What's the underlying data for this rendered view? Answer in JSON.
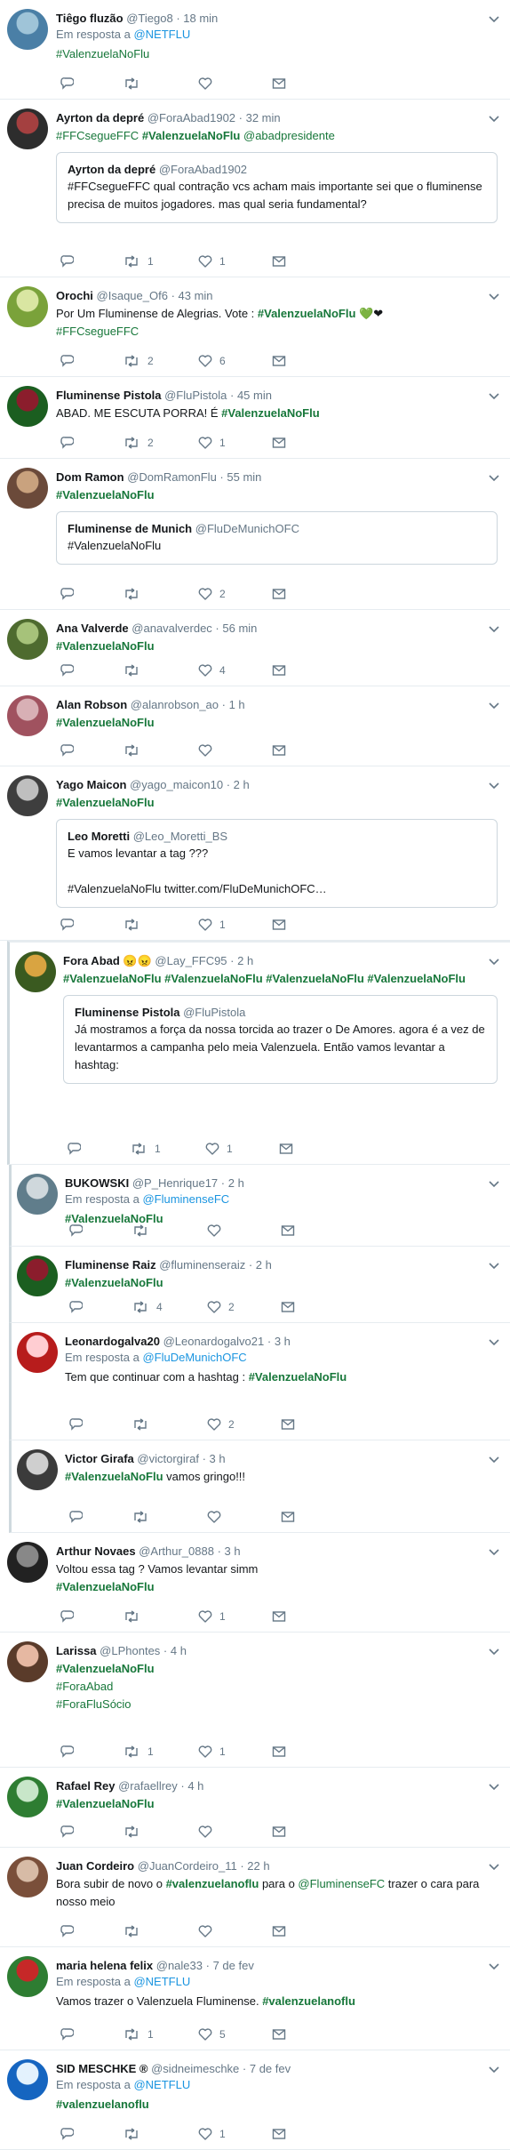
{
  "colors": {
    "hashtag": "#17773a",
    "link": "#1b95e0",
    "muted": "#657786",
    "border": "#e6ecf0"
  },
  "icons": {
    "reply": "reply-icon",
    "retweet": "retweet-icon",
    "like": "heart-icon",
    "dm": "envelope-icon",
    "menu": "chevron-down-icon"
  },
  "tweets": [
    {
      "name": "Tiêgo fluzão",
      "handle": "@Tiego8",
      "time": "18 min",
      "reply_prefix": "Em resposta a",
      "reply_to": "@NETFLU",
      "segments": [
        {
          "t": "#ValenzuelaNoFlu",
          "h": true
        }
      ],
      "rt": "",
      "likes": ""
    },
    {
      "name": "Ayrton da depré",
      "handle": "@ForaAbad1902",
      "time": "32 min",
      "segments": [
        {
          "t": "#FFCsegueFFC",
          "h": true
        },
        {
          "t": " "
        },
        {
          "t": "#ValenzuelaNoFlu",
          "h": true,
          "b": true
        },
        {
          "t": " "
        },
        {
          "t": "@abadpresidente",
          "h": true
        }
      ],
      "quote": {
        "name": "Ayrton da depré",
        "handle": "@ForaAbad1902",
        "text": "#FFCsegueFFC qual contração vcs acham mais importante sei que o fluminense precisa de muitos jogadores. mas qual seria fundamental?"
      },
      "rt": "1",
      "likes": "1"
    },
    {
      "name": "Orochi",
      "handle": "@Isaque_Of6",
      "time": "43 min",
      "segments": [
        {
          "t": "Por Um Fluminense de Alegrias. Vote : "
        },
        {
          "t": "#ValenzuelaNoFlu",
          "h": true,
          "b": true
        },
        {
          "t": " 💚❤"
        },
        {
          "t": "\n"
        },
        {
          "t": "#FFCsegueFFC",
          "h": true
        }
      ],
      "rt": "2",
      "likes": "6"
    },
    {
      "name": "Fluminense Pistola",
      "handle": "@FluPistola",
      "time": "45 min",
      "segments": [
        {
          "t": "ABAD. ME ESCUTA PORRA! É "
        },
        {
          "t": "#ValenzuelaNoFlu",
          "h": true,
          "b": true
        }
      ],
      "rt": "2",
      "likes": "1"
    },
    {
      "name": "Dom Ramon",
      "handle": "@DomRamonFlu",
      "time": "55 min",
      "segments": [
        {
          "t": "#ValenzuelaNoFlu",
          "h": true,
          "b": true
        }
      ],
      "quote": {
        "name": "Fluminense de Munich",
        "handle": "@FluDeMunichOFC",
        "text": "#ValenzuelaNoFlu"
      },
      "rt": "",
      "likes": "2"
    },
    {
      "name": "Ana Valverde",
      "handle": "@anavalverdec",
      "time": "56 min",
      "segments": [
        {
          "t": "#ValenzuelaNoFlu",
          "h": true,
          "b": true
        }
      ],
      "rt": "",
      "likes": "4"
    },
    {
      "name": "Alan Robson",
      "handle": "@alanrobson_ao",
      "time": "1 h",
      "segments": [
        {
          "t": "#ValenzuelaNoFlu",
          "h": true,
          "b": true
        }
      ],
      "rt": "",
      "likes": ""
    },
    {
      "name": "Yago Maicon",
      "handle": "@yago_maicon10",
      "time": "2 h",
      "segments": [
        {
          "t": "#ValenzuelaNoFlu",
          "h": true,
          "b": true
        }
      ],
      "quote": {
        "name": "Leo Moretti",
        "handle": "@Leo_Moretti_BS",
        "text": "E vamos levantar a tag ???\n\n#ValenzuelaNoFlu twitter.com/FluDeMunichOFC…"
      },
      "rt": "",
      "likes": "1"
    },
    {
      "name": "Fora Abad 😠😠",
      "handle": "@Lay_FFC95",
      "time": "2 h",
      "segments": [
        {
          "t": "#ValenzuelaNoFlu #ValenzuelaNoFlu #ValenzuelaNoFlu #ValenzuelaNoFlu",
          "h": true,
          "b": true
        }
      ],
      "quote": {
        "name": "Fluminense Pistola",
        "handle": "@FluPistola",
        "text": "Já mostramos a força da nossa torcida ao trazer o De Amores. agora é a vez de levantarmos a campanha pelo meia Valenzuela. Então vamos levantar a hashtag:"
      },
      "rt": "1",
      "likes": "1"
    },
    {
      "name": "BUKOWSKI",
      "handle": "@P_Henrique17",
      "time": "2 h",
      "reply_prefix": "Em resposta a",
      "reply_to": "@FluminenseFC",
      "segments": [
        {
          "t": "#ValenzuelaNoFlu",
          "h": true,
          "b": true
        }
      ],
      "rt": "",
      "likes": ""
    },
    {
      "name": "Fluminense Raiz",
      "handle": "@fluminenseraiz",
      "time": "2 h",
      "segments": [
        {
          "t": "#ValenzuelaNoFlu",
          "h": true,
          "b": true
        }
      ],
      "rt": "4",
      "likes": "2"
    },
    {
      "name": "Leonardogalva20",
      "handle": "@Leonardogalvo21",
      "time": "3 h",
      "reply_prefix": "Em resposta a",
      "reply_to": "@FluDeMunichOFC",
      "segments": [
        {
          "t": "Tem que continuar com a hashtag : "
        },
        {
          "t": "#ValenzuelaNoFlu",
          "h": true,
          "b": true
        }
      ],
      "rt": "",
      "likes": "2"
    },
    {
      "name": "Victor Girafa",
      "handle": "@victorgiraf",
      "time": "3 h",
      "segments": [
        {
          "t": "#ValenzuelaNoFlu",
          "h": true,
          "b": true
        },
        {
          "t": " vamos gringo!!!"
        }
      ],
      "rt": "",
      "likes": ""
    },
    {
      "name": "Arthur Novaes",
      "handle": "@Arthur_0888",
      "time": "3 h",
      "segments": [
        {
          "t": "Voltou essa tag ? Vamos levantar simm"
        },
        {
          "t": "\n"
        },
        {
          "t": "#ValenzuelaNoFlu",
          "h": true,
          "b": true
        }
      ],
      "rt": "",
      "likes": "1"
    },
    {
      "name": "Larissa",
      "handle": "@LPhontes",
      "time": "4 h",
      "segments": [
        {
          "t": "#ValenzuelaNoFlu",
          "h": true,
          "b": true
        },
        {
          "t": "\n"
        },
        {
          "t": "#ForaAbad",
          "h": true
        },
        {
          "t": "\n"
        },
        {
          "t": "#ForaFluSócio",
          "h": true
        }
      ],
      "rt": "1",
      "likes": "1"
    },
    {
      "name": "Rafael Rey",
      "handle": "@rafaellrey",
      "time": "4 h",
      "segments": [
        {
          "t": "#ValenzuelaNoFlu",
          "h": true,
          "b": true
        }
      ],
      "rt": "",
      "likes": ""
    },
    {
      "name": "Juan Cordeiro",
      "handle": "@JuanCordeiro_11",
      "time": "22 h",
      "segments": [
        {
          "t": "Bora subir de novo o "
        },
        {
          "t": "#valenzuelanoflu",
          "h": true,
          "b": true
        },
        {
          "t": " para o "
        },
        {
          "t": "@FluminenseFC",
          "h": true
        },
        {
          "t": " trazer o cara para nosso meio"
        }
      ],
      "rt": "",
      "likes": ""
    },
    {
      "name": "maria helena felix",
      "handle": "@nale33",
      "time": "7 de fev",
      "reply_prefix": "Em resposta a",
      "reply_to": "@NETFLU",
      "segments": [
        {
          "t": "Vamos trazer o Valenzuela Fluminense. "
        },
        {
          "t": "#valenzuelanoflu",
          "h": true,
          "b": true
        }
      ],
      "rt": "1",
      "likes": "5"
    },
    {
      "name": "SID MESCHKE ®",
      "handle": "@sidneimeschke",
      "time": "7 de fev",
      "reply_prefix": "Em resposta a",
      "reply_to": "@NETFLU",
      "segments": [
        {
          "t": "#valenzuelanoflu",
          "h": true,
          "b": true
        }
      ],
      "rt": "",
      "likes": "1"
    }
  ]
}
